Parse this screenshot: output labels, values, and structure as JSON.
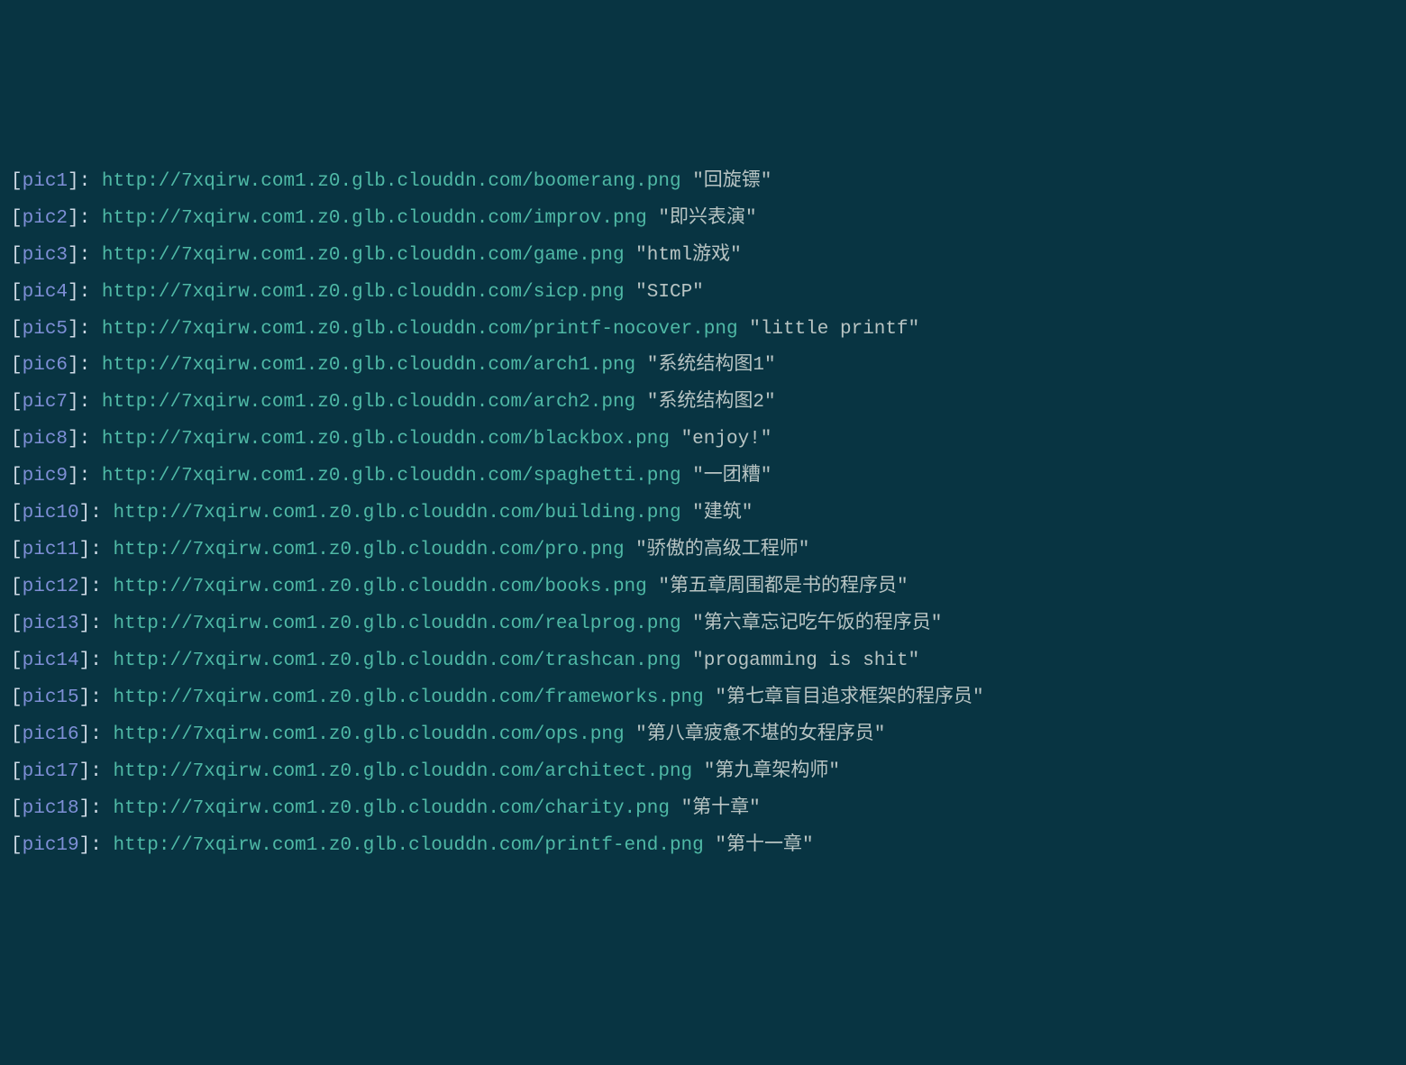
{
  "lines": [
    {
      "label": "pic1",
      "url": "http://7xqirw.com1.z0.glb.clouddn.com/boomerang.png",
      "title": "\"回旋镖\""
    },
    {
      "label": "pic2",
      "url": "http://7xqirw.com1.z0.glb.clouddn.com/improv.png",
      "title": "\"即兴表演\""
    },
    {
      "label": "pic3",
      "url": "http://7xqirw.com1.z0.glb.clouddn.com/game.png",
      "title": "\"html游戏\""
    },
    {
      "label": "pic4",
      "url": "http://7xqirw.com1.z0.glb.clouddn.com/sicp.png",
      "title": "\"SICP\""
    },
    {
      "label": "pic5",
      "url": "http://7xqirw.com1.z0.glb.clouddn.com/printf-nocover.png",
      "title": "\"little printf\""
    },
    {
      "label": "pic6",
      "url": "http://7xqirw.com1.z0.glb.clouddn.com/arch1.png",
      "title": "\"系统结构图1\""
    },
    {
      "label": "pic7",
      "url": "http://7xqirw.com1.z0.glb.clouddn.com/arch2.png",
      "title": "\"系统结构图2\""
    },
    {
      "label": "pic8",
      "url": "http://7xqirw.com1.z0.glb.clouddn.com/blackbox.png",
      "title": "\"enjoy!\""
    },
    {
      "label": "pic9",
      "url": "http://7xqirw.com1.z0.glb.clouddn.com/spaghetti.png",
      "title": "\"一团糟\""
    },
    {
      "label": "pic10",
      "url": "http://7xqirw.com1.z0.glb.clouddn.com/building.png",
      "title": "\"建筑\""
    },
    {
      "label": "pic11",
      "url": "http://7xqirw.com1.z0.glb.clouddn.com/pro.png",
      "title": "\"骄傲的高级工程师\""
    },
    {
      "label": "pic12",
      "url": "http://7xqirw.com1.z0.glb.clouddn.com/books.png",
      "title": "\"第五章周围都是书的程序员\""
    },
    {
      "label": "pic13",
      "url": "http://7xqirw.com1.z0.glb.clouddn.com/realprog.png",
      "title": "\"第六章忘记吃午饭的程序员\""
    },
    {
      "label": "pic14",
      "url": "http://7xqirw.com1.z0.glb.clouddn.com/trashcan.png",
      "title": "\"progamming is shit\""
    },
    {
      "label": "pic15",
      "url": "http://7xqirw.com1.z0.glb.clouddn.com/frameworks.png",
      "title": "\"第七章盲目追求框架的程序员\""
    },
    {
      "label": "pic16",
      "url": "http://7xqirw.com1.z0.glb.clouddn.com/ops.png",
      "title": "\"第八章疲惫不堪的女程序员\""
    },
    {
      "label": "pic17",
      "url": "http://7xqirw.com1.z0.glb.clouddn.com/architect.png",
      "title": "\"第九章架构师\""
    },
    {
      "label": "pic18",
      "url": "http://7xqirw.com1.z0.glb.clouddn.com/charity.png",
      "title": "\"第十章\""
    },
    {
      "label": "pic19",
      "url": "http://7xqirw.com1.z0.glb.clouddn.com/printf-end.png",
      "title": "\"第十一章\""
    }
  ]
}
